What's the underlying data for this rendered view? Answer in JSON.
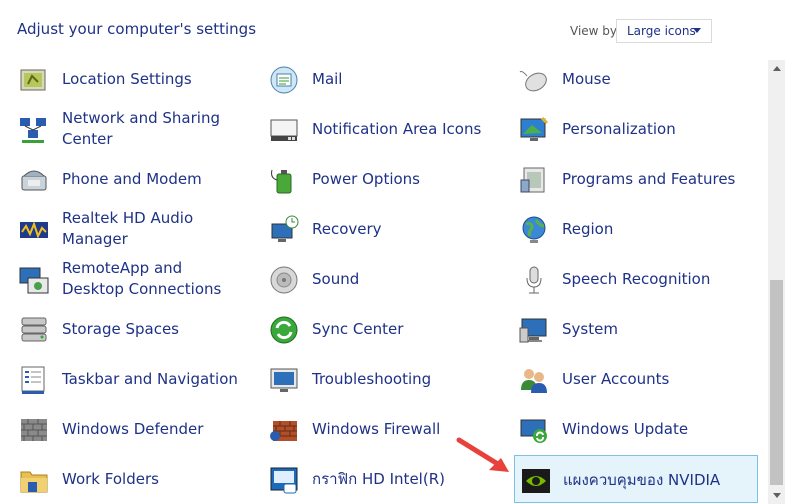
{
  "header": {
    "title": "Adjust your computer's settings",
    "view_by_label": "View by:",
    "view_by_value": "Large icons"
  },
  "items": [
    {
      "label": "Location Settings",
      "icon": "location-icon"
    },
    {
      "label": "Mail",
      "icon": "mail-icon"
    },
    {
      "label": "Mouse",
      "icon": "mouse-icon"
    },
    {
      "label": "Network and Sharing Center",
      "icon": "network-icon"
    },
    {
      "label": "Notification Area Icons",
      "icon": "notification-area-icon"
    },
    {
      "label": "Personalization",
      "icon": "personalization-icon"
    },
    {
      "label": "Phone and Modem",
      "icon": "phone-icon"
    },
    {
      "label": "Power Options",
      "icon": "power-icon"
    },
    {
      "label": "Programs and Features",
      "icon": "programs-icon"
    },
    {
      "label": "Realtek HD Audio Manager",
      "icon": "audio-manager-icon"
    },
    {
      "label": "Recovery",
      "icon": "recovery-icon"
    },
    {
      "label": "Region",
      "icon": "region-globe-icon"
    },
    {
      "label": "RemoteApp and Desktop Connections",
      "icon": "remote-desktop-icon"
    },
    {
      "label": "Sound",
      "icon": "speaker-icon"
    },
    {
      "label": "Speech Recognition",
      "icon": "microphone-icon"
    },
    {
      "label": "Storage Spaces",
      "icon": "storage-icon"
    },
    {
      "label": "Sync Center",
      "icon": "sync-icon"
    },
    {
      "label": "System",
      "icon": "system-monitor-icon"
    },
    {
      "label": "Taskbar and Navigation",
      "icon": "taskbar-icon"
    },
    {
      "label": "Troubleshooting",
      "icon": "troubleshooting-icon"
    },
    {
      "label": "User Accounts",
      "icon": "users-icon"
    },
    {
      "label": "Windows Defender",
      "icon": "defender-wall-icon"
    },
    {
      "label": "Windows Firewall",
      "icon": "firewall-icon"
    },
    {
      "label": "Windows Update",
      "icon": "windows-update-icon"
    },
    {
      "label": "Work Folders",
      "icon": "folder-icon"
    },
    {
      "label": "กราฟิก HD Intel(R)",
      "icon": "intel-graphics-icon"
    },
    {
      "label": "แผงควบคุมของ NVIDIA",
      "icon": "nvidia-icon",
      "selected": true
    }
  ],
  "colors": {
    "link": "#1e3287",
    "selection_bg": "#e5f3fb",
    "selection_border": "#7dc2e6",
    "annotation_arrow": "#e8403a"
  }
}
